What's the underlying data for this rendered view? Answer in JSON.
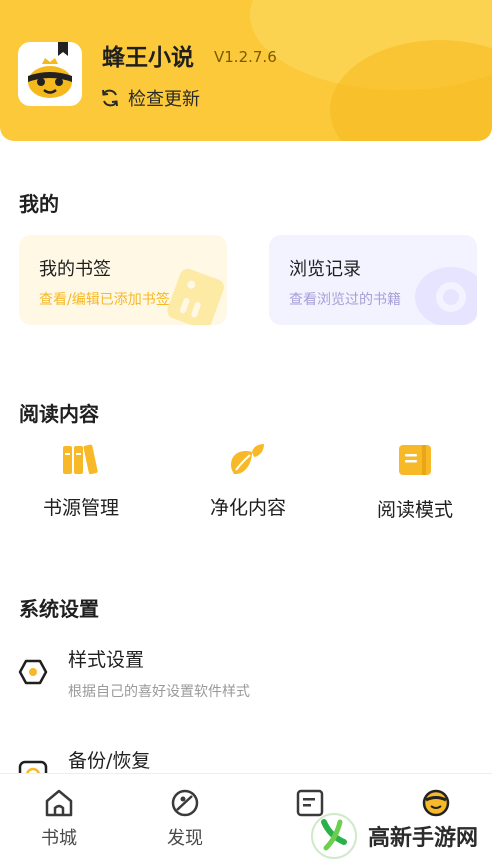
{
  "header": {
    "app_name": "蜂王小说",
    "version": "V1.2.7.6",
    "update_label": "检查更新"
  },
  "mine": {
    "title": "我的",
    "bookmark": {
      "title": "我的书签",
      "subtitle": "查看/编辑已添加书签"
    },
    "history": {
      "title": "浏览记录",
      "subtitle": "查看浏览过的书籍"
    }
  },
  "reading": {
    "title": "阅读内容",
    "items": [
      {
        "label": "书源管理",
        "icon": "bookshelf-icon"
      },
      {
        "label": "净化内容",
        "icon": "leaf-icon"
      },
      {
        "label": "阅读模式",
        "icon": "open-book-icon"
      }
    ]
  },
  "settings": {
    "title": "系统设置",
    "items": [
      {
        "title": "样式设置",
        "subtitle": "根据自己的喜好设置软件样式",
        "icon": "hexagon-icon"
      },
      {
        "title": "备份/恢复",
        "subtitle": "",
        "icon": "backup-icon"
      }
    ]
  },
  "nav": {
    "items": [
      {
        "label": "书城",
        "icon": "home-icon"
      },
      {
        "label": "发现",
        "icon": "compass-icon"
      },
      {
        "label": "",
        "icon": "list-icon"
      },
      {
        "label": "",
        "icon": "bee-face-icon"
      }
    ]
  },
  "watermark": {
    "text": "高新手游网"
  },
  "colors": {
    "accent": "#fbc93a",
    "accent_dark": "#f6b825",
    "purple_soft": "#a4a0d8"
  }
}
